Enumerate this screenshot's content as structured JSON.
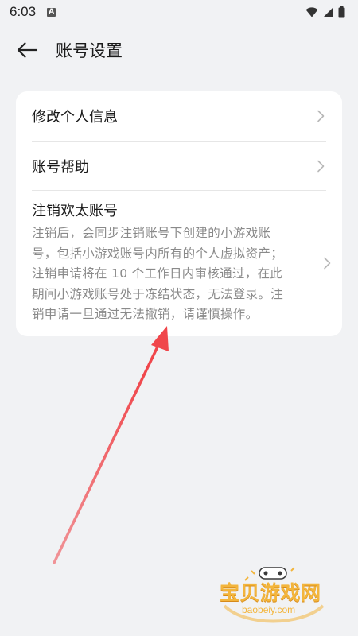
{
  "status_bar": {
    "time": "6:03",
    "notification_icon": "A"
  },
  "header": {
    "title": "账号设置",
    "back_icon": "arrow-left-icon"
  },
  "settings": {
    "items": [
      {
        "label": "修改个人信息"
      },
      {
        "label": "账号帮助"
      }
    ],
    "deregister": {
      "title": "注销欢太账号",
      "description": "注销后，会同步注销账号下创建的小游戏账号，包括小游戏账号内所有的个人虚拟资产；注销申请将在 10 个工作日内审核通过，在此期间小游戏账号处于冻结状态，无法登录。注销申请一旦通过无法撤销，请谨慎操作。"
    }
  },
  "watermark": {
    "name": "宝贝游戏网",
    "url": "baobeiy.com"
  },
  "colors": {
    "background": "#f1f2f4",
    "card": "#ffffff",
    "primary_text": "#1a1a1a",
    "secondary_text": "#8a8a8a",
    "annotation_arrow": "#f0464b",
    "watermark": "#f3b53c"
  }
}
